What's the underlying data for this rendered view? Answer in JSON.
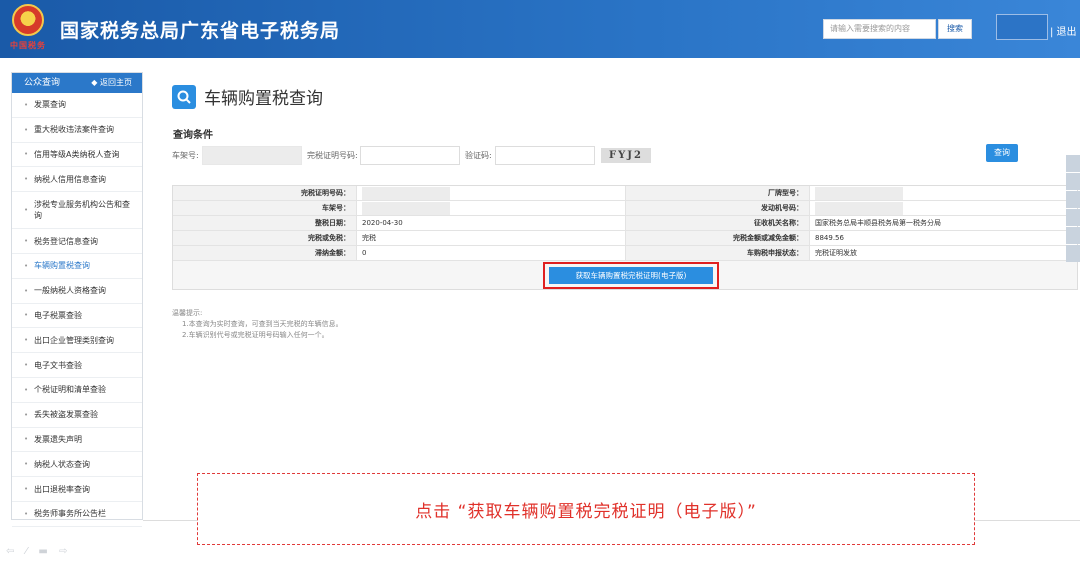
{
  "header": {
    "title": "国家税务总局广东省电子税务局",
    "emblem_text": "中国税务",
    "search_placeholder": "请输入需要搜索的内容",
    "search_label": "搜索",
    "logout_label": "| 退出"
  },
  "sidebar": {
    "title": "公众查询",
    "home_label": "◆ 返回主页",
    "items": [
      {
        "label": "发票查询"
      },
      {
        "label": "重大税收违法案件查询"
      },
      {
        "label": "信用等级A类纳税人查询"
      },
      {
        "label": "纳税人信用信息查询"
      },
      {
        "label": "涉税专业服务机构公告和查询"
      },
      {
        "label": "税务登记信息查询"
      },
      {
        "label": "车辆购置税查询"
      },
      {
        "label": "一般纳税人资格查询"
      },
      {
        "label": "电子税票查验"
      },
      {
        "label": "出口企业管理类别查询"
      },
      {
        "label": "电子文书查验"
      },
      {
        "label": "个税证明和清单查验"
      },
      {
        "label": "丢失被盗发票查验"
      },
      {
        "label": "发票遗失声明"
      },
      {
        "label": "纳税人状态查询"
      },
      {
        "label": "出口退税率查询"
      },
      {
        "label": "税务师事务所公告栏"
      }
    ]
  },
  "main": {
    "page_title": "车辆购置税查询",
    "conditions_label": "查询条件",
    "fields": {
      "vin_label": "车架号:",
      "cert_label": "完税证明号码:",
      "captcha_label": "验证码:",
      "captcha_text": "FYJ2"
    },
    "query_button": "查询",
    "result_rows": [
      {
        "l1": "完税证明号码：",
        "v1": "",
        "l2": "厂牌型号：",
        "v2": ""
      },
      {
        "l1": "车架号：",
        "v1": "",
        "l2": "发动机号码：",
        "v2": ""
      },
      {
        "l1": "整税日期：",
        "v1": "2020-04-30",
        "l2": "征收机关名称：",
        "v2": "国家税务总局丰顺县税务局第一税务分局"
      },
      {
        "l1": "完税或免税：",
        "v1": "完税",
        "l2": "完税金额或减免金额：",
        "v2": "8849.56"
      },
      {
        "l1": "滞纳金额：",
        "v1": "0",
        "l2": "车购税申报状态：",
        "v2": "完税证明发放"
      }
    ],
    "get_cert_button": "获取车辆购置税完税证明(电子版)",
    "tips": [
      "温馨提示:",
      "1.本查询为实时查询，可查到当天完税的车辆信息。",
      "2.车辆识别代号或完税证明号码输入任何一个。"
    ]
  },
  "callout": {
    "text": "点击 “获取车辆购置税完税证明（电子版）”"
  },
  "colors": {
    "header_blue": "#1a5aa8",
    "accent_blue": "#2b8ee0",
    "highlight_red": "#e02020"
  }
}
